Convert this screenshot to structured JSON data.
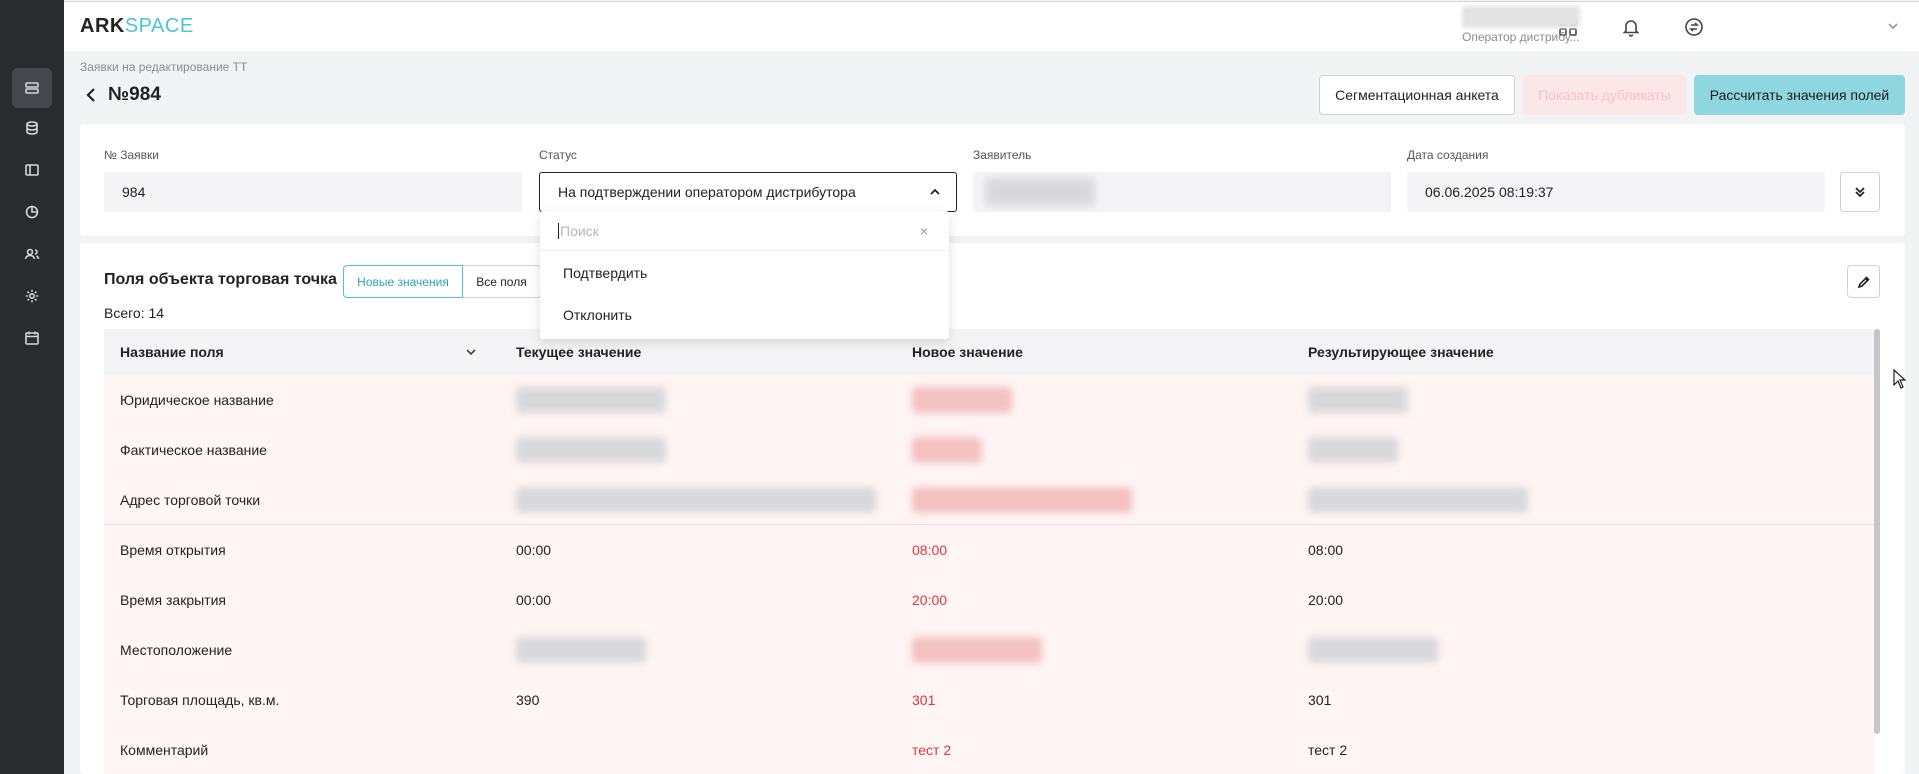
{
  "app": {
    "logo_ark": "ARK",
    "logo_space": "SPACE"
  },
  "user": {
    "role": "Оператор дистрибу..."
  },
  "icons": {
    "rail": [
      "list-icon",
      "database-icon",
      "layout-icon",
      "chart-pie-icon",
      "users-icon",
      "gear-icon",
      "calendar-icon"
    ],
    "header": [
      "grid-icon",
      "bell-icon",
      "sync-icon",
      "chevron-down-icon"
    ]
  },
  "breadcrumb": "Заявки на редактирование ТТ",
  "title": "№984",
  "actions": {
    "segment_form": "Сегментационная анкета",
    "show_duplicates": "Показать дубликаты",
    "calculate": "Рассчитать значения полей"
  },
  "form": {
    "request_no_label": "№ Заявки",
    "request_no_value": "984",
    "status_label": "Статус",
    "status_value": "На подтверждении оператором дистрибутора",
    "applicant_label": "Заявитель",
    "created_label": "Дата создания",
    "created_value": "06.06.2025 08:19:37"
  },
  "dropdown": {
    "search_placeholder": "Поиск",
    "clear": "×",
    "options": [
      "Подтвердить",
      "Отклонить"
    ]
  },
  "section": {
    "title": "Поля объекта торговая точка",
    "tab_new": "Новые значения",
    "tab_all": "Все поля",
    "total": "Всего: 14"
  },
  "table": {
    "headers": [
      "Название поля",
      "Текущее значение",
      "Новое значение",
      "Результирующее значение"
    ],
    "rows": [
      {
        "name": "Юридическое название",
        "current": "",
        "new": "",
        "result": ""
      },
      {
        "name": "Фактическое название",
        "current": "",
        "new": "",
        "result": ""
      },
      {
        "name": "Адрес торговой точки",
        "current": "",
        "new": "",
        "result": ""
      },
      {
        "name": "Время открытия",
        "current": "00:00",
        "new": "08:00",
        "result": "08:00"
      },
      {
        "name": "Время закрытия",
        "current": "00:00",
        "new": "20:00",
        "result": "20:00"
      },
      {
        "name": "Местоположение",
        "current": "",
        "new": "",
        "result": ""
      },
      {
        "name": "Торговая площадь, кв.м.",
        "current": "390",
        "new": "301",
        "result": "301"
      },
      {
        "name": "Комментарий",
        "current": "",
        "new": "тест 2",
        "result": "тест 2"
      }
    ]
  },
  "colors": {
    "accent": "#4fc3d6",
    "primary_button": "#8fd7e0",
    "new_value": "#d93b3b",
    "row_highlight": "#fff5f5",
    "rail": "#2a2b2e"
  }
}
